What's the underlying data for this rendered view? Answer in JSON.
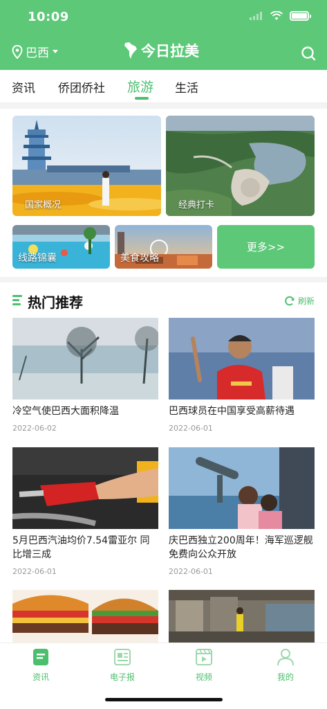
{
  "status": {
    "time": "10:09"
  },
  "header": {
    "location": "巴西",
    "brand": "今日拉美"
  },
  "tabs": [
    {
      "label": "资讯"
    },
    {
      "label": "侨团侨社"
    },
    {
      "label": "旅游"
    },
    {
      "label": "生活"
    }
  ],
  "tiles": {
    "country": "国家概况",
    "classic": "经典打卡",
    "routes": "线路锦囊",
    "food": "美食攻略",
    "more": "更多>>"
  },
  "section": {
    "title": "热门推荐",
    "refresh": "刷新"
  },
  "news": [
    {
      "title": "冷空气使巴西大面积降温",
      "date": "2022-06-02"
    },
    {
      "title": "巴西球员在中国享受高薪待遇",
      "date": "2022-06-01"
    },
    {
      "title": "5月巴西汽油均价7.54雷亚尔 同比增三成",
      "date": "2022-06-01"
    },
    {
      "title": "庆巴西独立200周年！海军巡逻舰免费向公众开放",
      "date": "2022-06-01"
    }
  ],
  "tabbar": [
    {
      "label": "资讯"
    },
    {
      "label": "电子报"
    },
    {
      "label": "视频"
    },
    {
      "label": "我的"
    }
  ],
  "colors": {
    "accent": "#5cc878",
    "active": "#4cbf6e"
  }
}
